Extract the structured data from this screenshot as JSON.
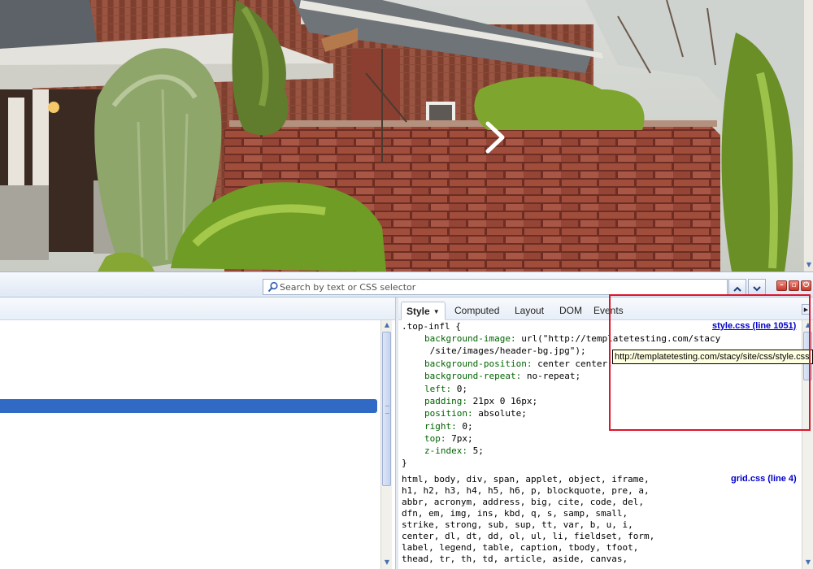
{
  "page": {
    "photo_description_icon": "house-photo",
    "slider_next_icon": "chevron-right-icon"
  },
  "firebug": {
    "search": {
      "placeholder": "Search by text or CSS selector",
      "icon": "search-icon"
    },
    "nav": {
      "up_icon": "chevron-up-icon",
      "down_icon": "chevron-down-icon"
    },
    "window_buttons": {
      "minimize_icon": "minimize-icon",
      "detach_icon": "detach-icon",
      "close_icon": "power-icon"
    },
    "side_tabs": [
      "Style",
      "Computed",
      "Layout",
      "DOM",
      "Events"
    ],
    "active_tab": "Style",
    "rules": [
      {
        "selector": ".top-infl {",
        "source": "style.css (line 1051)",
        "declarations": [
          {
            "prop": "background-image:",
            "value": " url(\"http://templatetesting.com/stacy"
          },
          {
            "prop": "",
            "value": " /site/images/header-bg.jpg\");"
          },
          {
            "prop": "background-position:",
            "value": " center center;"
          },
          {
            "prop": "background-repeat:",
            "value": " no-repeat;"
          },
          {
            "prop": "left:",
            "value": " 0;"
          },
          {
            "prop": "padding:",
            "value": " 21px 0 16px;"
          },
          {
            "prop": "position:",
            "value": " absolute;"
          },
          {
            "prop": "right:",
            "value": " 0;"
          },
          {
            "prop": "top:",
            "value": " 7px;"
          },
          {
            "prop": "z-index:",
            "value": " 5;"
          }
        ],
        "close": "}"
      },
      {
        "source": "grid.css (line 4)",
        "selector_lines": [
          "html, body, div, span, applet, object, iframe,",
          "h1, h2, h3, h4, h5, h6, p, blockquote, pre, a,",
          "abbr, acronym, address, big, cite, code, del,",
          "dfn, em, img, ins, kbd, q, s, samp, small,",
          "strike, strong, sub, sup, tt, var, b, u, i,",
          "center, dl, dt, dd, ol, ul, li, fieldset, form,",
          "label, legend, table, caption, tbody, tfoot,",
          "thead, tr, th, td, article, aside, canvas,"
        ]
      }
    ],
    "tooltip": "http://templatetesting.com/stacy/site/css/style.css",
    "colors": {
      "property": "#006400",
      "link": "#0000cc",
      "selection": "#316ac5",
      "highlight_box": "#e0142a"
    }
  }
}
